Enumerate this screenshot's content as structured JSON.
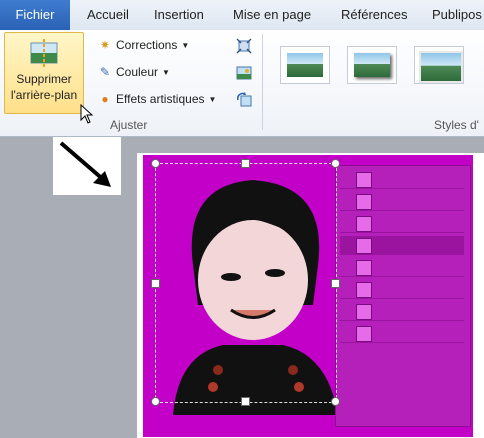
{
  "tabs": {
    "file": "Fichier",
    "home": "Accueil",
    "insert": "Insertion",
    "layout": "Mise en page",
    "references": "Références",
    "publipostage": "Publipos"
  },
  "adjust": {
    "remove_bg_line1": "Supprimer",
    "remove_bg_line2": "l'arrière-plan",
    "corrections": "Corrections",
    "color": "Couleur",
    "artistic": "Effets artistiques",
    "group_label": "Ajuster"
  },
  "styles": {
    "group_label": "Styles d'"
  },
  "colors": {
    "accent": "#2b62b5",
    "picture_bg": "#c300c8"
  }
}
